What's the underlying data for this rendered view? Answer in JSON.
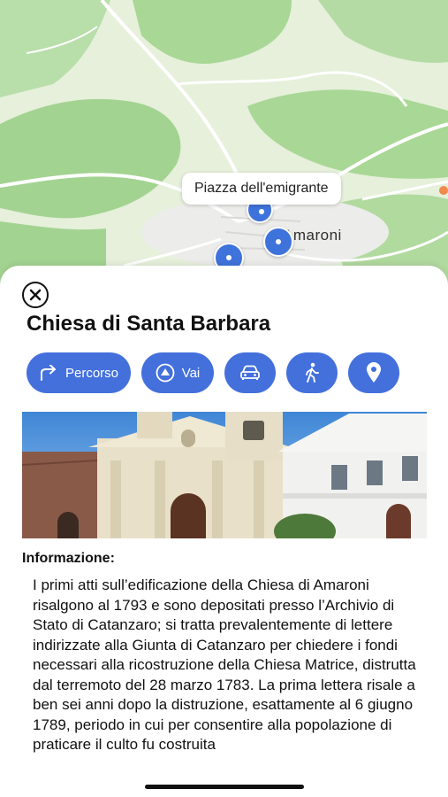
{
  "map": {
    "town_label": "Amaroni",
    "callout": "Piazza dell'emigrante"
  },
  "place": {
    "title": "Chiesa di Santa Barbara"
  },
  "actions": [
    {
      "label": "Percorso",
      "icon": "turn-right-arrow-icon"
    },
    {
      "label": "Vai",
      "icon": "navigation-arrow-icon"
    },
    {
      "icon": "car-icon"
    },
    {
      "icon": "walking-person-icon"
    },
    {
      "icon": "location-pin-icon"
    }
  ],
  "info": {
    "heading": "Informazione:",
    "body": "I primi atti sull’edificazione della Chiesa di Amaroni risalgono al 1793 e sono depositati presso l’Archivio di Stato di Catanzaro; si tratta prevalentemente di lettere indirizzate alla Giunta di Catanzaro per chiedere i fondi necessari alla ricostruzione della Chiesa Matrice, distrutta dal terremoto del 28 marzo 1783. La prima lettera risale a ben sei anni dopo la distruzione, esattamente al 6 giugno 1789, periodo in cui per consentire alla popolazione di praticare il culto fu costruita"
  },
  "colors": {
    "accent": "#4470dc",
    "map_land": "#e3efd7",
    "map_forest": "#a9d796",
    "pin": "#3f73dc"
  }
}
